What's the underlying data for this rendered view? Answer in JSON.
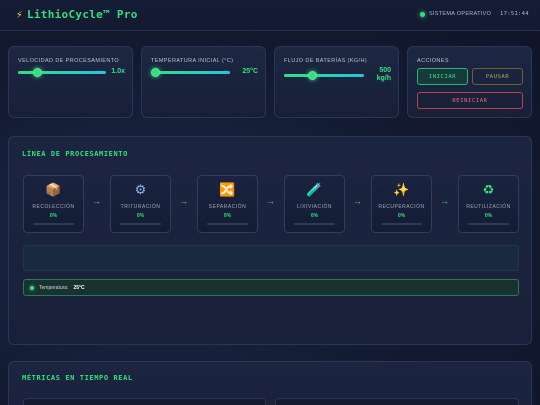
{
  "header": {
    "brand_icon": "⚡",
    "brand_name": "LithioCycle™ Pro",
    "status_text": "SISTEMA OPERATIVO",
    "time": "17:51:44"
  },
  "controls": {
    "speed": {
      "label": "VELOCIDAD DE PROCESAMIENTO",
      "value_text": "1.0x",
      "level": 0.22
    },
    "temperature": {
      "label": "TEMPERATURA INICIAL (°C)",
      "value_text": "25°C",
      "level": 0.06
    },
    "flow": {
      "label": "FLUJO DE BATERÍAS (KG/H)",
      "value_line1": "500",
      "value_line2": "kg/h",
      "level": 0.35
    },
    "actions": {
      "label": "ACCIONES",
      "start": "INICIAR",
      "pause": "PAUSAR",
      "reset": "REINICIAR"
    }
  },
  "line": {
    "title": "LÍNEA DE PROCESAMIENTO",
    "stages": [
      {
        "icon": "📦",
        "icon_name": "package-icon",
        "name": "RECOLECCIÓN",
        "pct": "0%"
      },
      {
        "icon": "⚙",
        "icon_name": "gear-icon",
        "name": "TRITURACIÓN",
        "pct": "0%"
      },
      {
        "icon": "🔀",
        "icon_name": "shuffle-icon",
        "name": "SEPARACIÓN",
        "pct": "0%"
      },
      {
        "icon": "🧪",
        "icon_name": "test-tube-icon",
        "name": "LIXIVIACIÓN",
        "pct": "0%"
      },
      {
        "icon": "✨",
        "icon_name": "sparkles-icon",
        "name": "RECUPERACIÓN",
        "pct": "0%"
      },
      {
        "icon": "♻",
        "icon_name": "recycle-icon",
        "name": "REUTILIZACIÓN",
        "pct": "0%"
      }
    ],
    "arrow": "→",
    "temp_label": "Temperatura:",
    "temp_value": "25°C"
  },
  "metrics": {
    "title": "MÉTRICAS EN TIEMPO REAL"
  },
  "colors": {
    "accent": "#34e07e",
    "reset": "#ee6a72",
    "pause": "#b9a457",
    "background": "#131a30"
  }
}
